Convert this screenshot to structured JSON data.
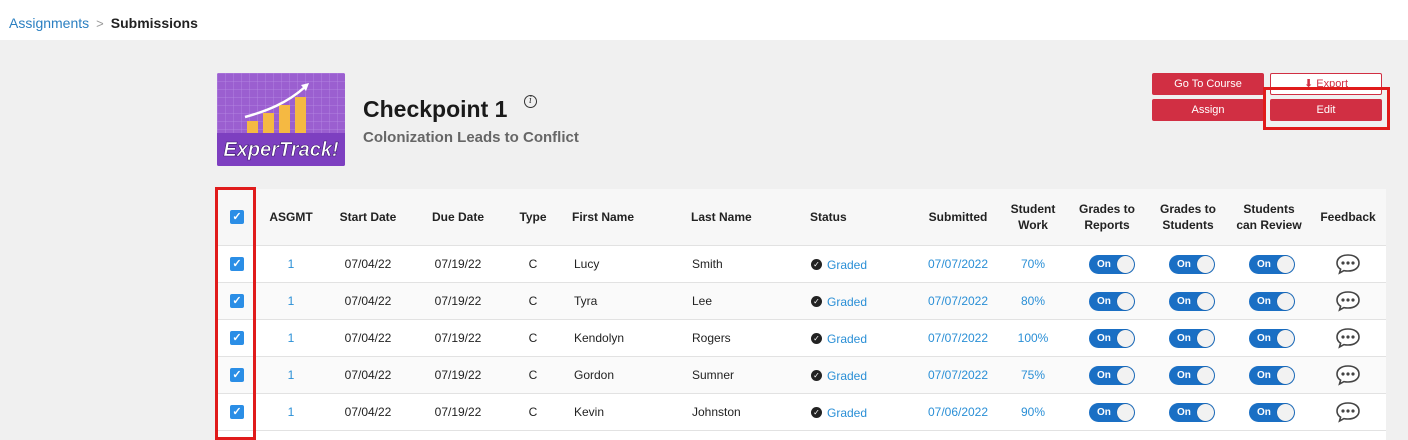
{
  "breadcrumb": {
    "parent": "Assignments",
    "separator": ">",
    "current": "Submissions"
  },
  "assignment": {
    "title": "Checkpoint 1",
    "subtitle": "Colonization Leads to Conflict",
    "thumbnail_text": "ExperTrack!",
    "info_icon": "i"
  },
  "actions": {
    "go_to_course": "Go To Course",
    "export": "Export",
    "assign": "Assign",
    "edit": "Edit"
  },
  "table": {
    "headers": {
      "asgmt": "ASGMT",
      "start_date": "Start Date",
      "due_date": "Due Date",
      "type": "Type",
      "first_name": "First Name",
      "last_name": "Last Name",
      "status": "Status",
      "submitted": "Submitted",
      "student_work_1": "Student",
      "student_work_2": "Work",
      "grades_reports_1": "Grades to",
      "grades_reports_2": "Reports",
      "grades_students_1": "Grades to",
      "grades_students_2": "Students",
      "students_review_1": "Students",
      "students_review_2": "can Review",
      "feedback": "Feedback"
    },
    "toggle_label": "On",
    "rows": [
      {
        "asgmt": "1",
        "start": "07/04/22",
        "due": "07/19/22",
        "type": "C",
        "first": "Lucy",
        "last": "Smith",
        "status": "Graded",
        "submitted": "07/07/2022",
        "work": "70%"
      },
      {
        "asgmt": "1",
        "start": "07/04/22",
        "due": "07/19/22",
        "type": "C",
        "first": "Tyra",
        "last": "Lee",
        "status": "Graded",
        "submitted": "07/07/2022",
        "work": "80%"
      },
      {
        "asgmt": "1",
        "start": "07/04/22",
        "due": "07/19/22",
        "type": "C",
        "first": "Kendolyn",
        "last": "Rogers",
        "status": "Graded",
        "submitted": "07/07/2022",
        "work": "100%"
      },
      {
        "asgmt": "1",
        "start": "07/04/22",
        "due": "07/19/22",
        "type": "C",
        "first": "Gordon",
        "last": "Sumner",
        "status": "Graded",
        "submitted": "07/07/2022",
        "work": "75%"
      },
      {
        "asgmt": "1",
        "start": "07/04/22",
        "due": "07/19/22",
        "type": "C",
        "first": "Kevin",
        "last": "Johnston",
        "status": "Graded",
        "submitted": "07/06/2022",
        "work": "90%"
      }
    ]
  },
  "colors": {
    "brand_red": "#d12f43",
    "link_blue": "#2a8fd6",
    "toggle_blue": "#1a6fc4",
    "highlight_red": "#e01b1b"
  }
}
